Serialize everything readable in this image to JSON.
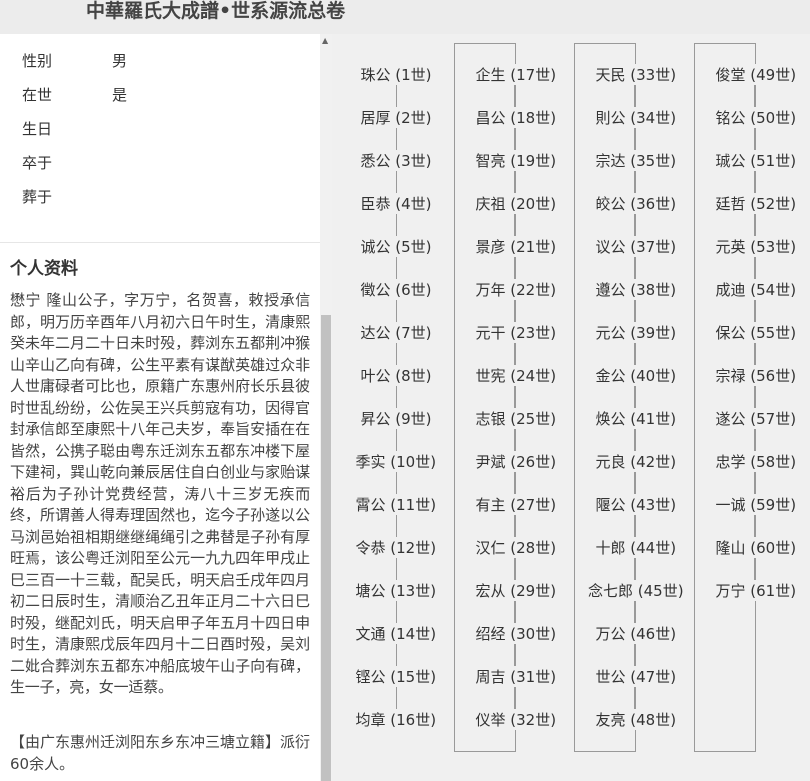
{
  "header": {
    "title": "中華羅氏大成譜•世系源流总卷"
  },
  "person": {
    "fields": [
      {
        "label": "性别",
        "value": "男"
      },
      {
        "label": "在世",
        "value": "是"
      },
      {
        "label": "生日",
        "value": ""
      },
      {
        "label": "卒于",
        "value": ""
      },
      {
        "label": "葬于",
        "value": ""
      }
    ],
    "profile_heading": "个人资料",
    "bio": "懋宁 隆山公子，字万宁，名贺喜，敕授承信郎，明万历辛酉年八月初六日午时生，清康熙癸未年二月二十日未时殁，葬浏东五都荆冲猴山辛山乙向有碑，公生平素有谋猷英雄过众非人世庸碌者可比也，原籍广东惠州府长乐县彼时世乱纷纷，公佐吴王兴兵剪寇有功，因得官封承信郎至康熙十八年己夫岁，奉旨安插在在皆然，公携子聪由粤东迁浏东五都东冲楼下屋下建祠，巽山乾向兼辰居住自白创业与家贻谋裕后为子孙计党费经营，涛八十三岁无疾而终，所谓善人得寿理固然也，迄今子孙遂以公马浏邑始祖相期继继绳绳引之弗替是子孙有厚旺焉，该公粤迁浏阳至公元一九九四年甲戌止巳三百一十三载，配吴氏，明天启壬戌年四月初二日辰时生，清顺治乙丑年正月二十六日巳时殁，继配刘氏，明天启甲子年五月十四日申时生，清康熙戊辰年四月十二日酉时殁，吴刘二妣合葬浏东五都东冲船底坡午山子向有碑，生一子，亮，女一适蔡。",
    "note": "【由广东惠州迁浏阳东乡东冲三塘立籍】派衍60余人。"
  },
  "lineage": [
    [
      {
        "name": "珠公",
        "gen": "(1世)"
      },
      {
        "name": "居厚",
        "gen": "(2世)"
      },
      {
        "name": "悉公",
        "gen": "(3世)"
      },
      {
        "name": "臣恭",
        "gen": "(4世)"
      },
      {
        "name": "诚公",
        "gen": "(5世)"
      },
      {
        "name": "徵公",
        "gen": "(6世)"
      },
      {
        "name": "达公",
        "gen": "(7世)"
      },
      {
        "name": "叶公",
        "gen": "(8世)"
      },
      {
        "name": "昇公",
        "gen": "(9世)"
      },
      {
        "name": "季实",
        "gen": "(10世)"
      },
      {
        "name": "霄公",
        "gen": "(11世)"
      },
      {
        "name": "令恭",
        "gen": "(12世)"
      },
      {
        "name": "塘公",
        "gen": "(13世)"
      },
      {
        "name": "文通",
        "gen": "(14世)"
      },
      {
        "name": "铿公",
        "gen": "(15世)"
      },
      {
        "name": "均章",
        "gen": "(16世)"
      }
    ],
    [
      {
        "name": "企生",
        "gen": "(17世)"
      },
      {
        "name": "昌公",
        "gen": "(18世)"
      },
      {
        "name": "智亮",
        "gen": "(19世)"
      },
      {
        "name": "庆祖",
        "gen": "(20世)"
      },
      {
        "name": "景彦",
        "gen": "(21世)"
      },
      {
        "name": "万年",
        "gen": "(22世)"
      },
      {
        "name": "元干",
        "gen": "(23世)"
      },
      {
        "name": "世宪",
        "gen": "(24世)"
      },
      {
        "name": "志银",
        "gen": "(25世)"
      },
      {
        "name": "尹斌",
        "gen": "(26世)"
      },
      {
        "name": "有主",
        "gen": "(27世)"
      },
      {
        "name": "汉仁",
        "gen": "(28世)"
      },
      {
        "name": "宏从",
        "gen": "(29世)"
      },
      {
        "name": "绍经",
        "gen": "(30世)"
      },
      {
        "name": "周吉",
        "gen": "(31世)"
      },
      {
        "name": "仪举",
        "gen": "(32世)"
      }
    ],
    [
      {
        "name": "天民",
        "gen": "(33世)"
      },
      {
        "name": "則公",
        "gen": "(34世)"
      },
      {
        "name": "宗达",
        "gen": "(35世)"
      },
      {
        "name": "皎公",
        "gen": "(36世)"
      },
      {
        "name": "议公",
        "gen": "(37世)"
      },
      {
        "name": "遵公",
        "gen": "(38世)"
      },
      {
        "name": "元公",
        "gen": "(39世)"
      },
      {
        "name": "金公",
        "gen": "(40世)"
      },
      {
        "name": "焕公",
        "gen": "(41世)"
      },
      {
        "name": "元良",
        "gen": "(42世)"
      },
      {
        "name": "隁公",
        "gen": "(43世)"
      },
      {
        "name": "十郎",
        "gen": "(44世)"
      },
      {
        "name": "念七郎",
        "gen": "(45世)"
      },
      {
        "name": "万公",
        "gen": "(46世)"
      },
      {
        "name": "世公",
        "gen": "(47世)"
      },
      {
        "name": "友亮",
        "gen": "(48世)"
      }
    ],
    [
      {
        "name": "俊堂",
        "gen": "(49世)"
      },
      {
        "name": "铭公",
        "gen": "(50世)"
      },
      {
        "name": "珹公",
        "gen": "(51世)"
      },
      {
        "name": "廷哲",
        "gen": "(52世)"
      },
      {
        "name": "元英",
        "gen": "(53世)"
      },
      {
        "name": "成迪",
        "gen": "(54世)"
      },
      {
        "name": "保公",
        "gen": "(55世)"
      },
      {
        "name": "宗禄",
        "gen": "(56世)"
      },
      {
        "name": "遂公",
        "gen": "(57世)"
      },
      {
        "name": "忠学",
        "gen": "(58世)"
      },
      {
        "name": "一诚",
        "gen": "(59世)"
      },
      {
        "name": "隆山",
        "gen": "(60世)"
      },
      {
        "name": "万宁",
        "gen": "(61世)"
      }
    ]
  ]
}
